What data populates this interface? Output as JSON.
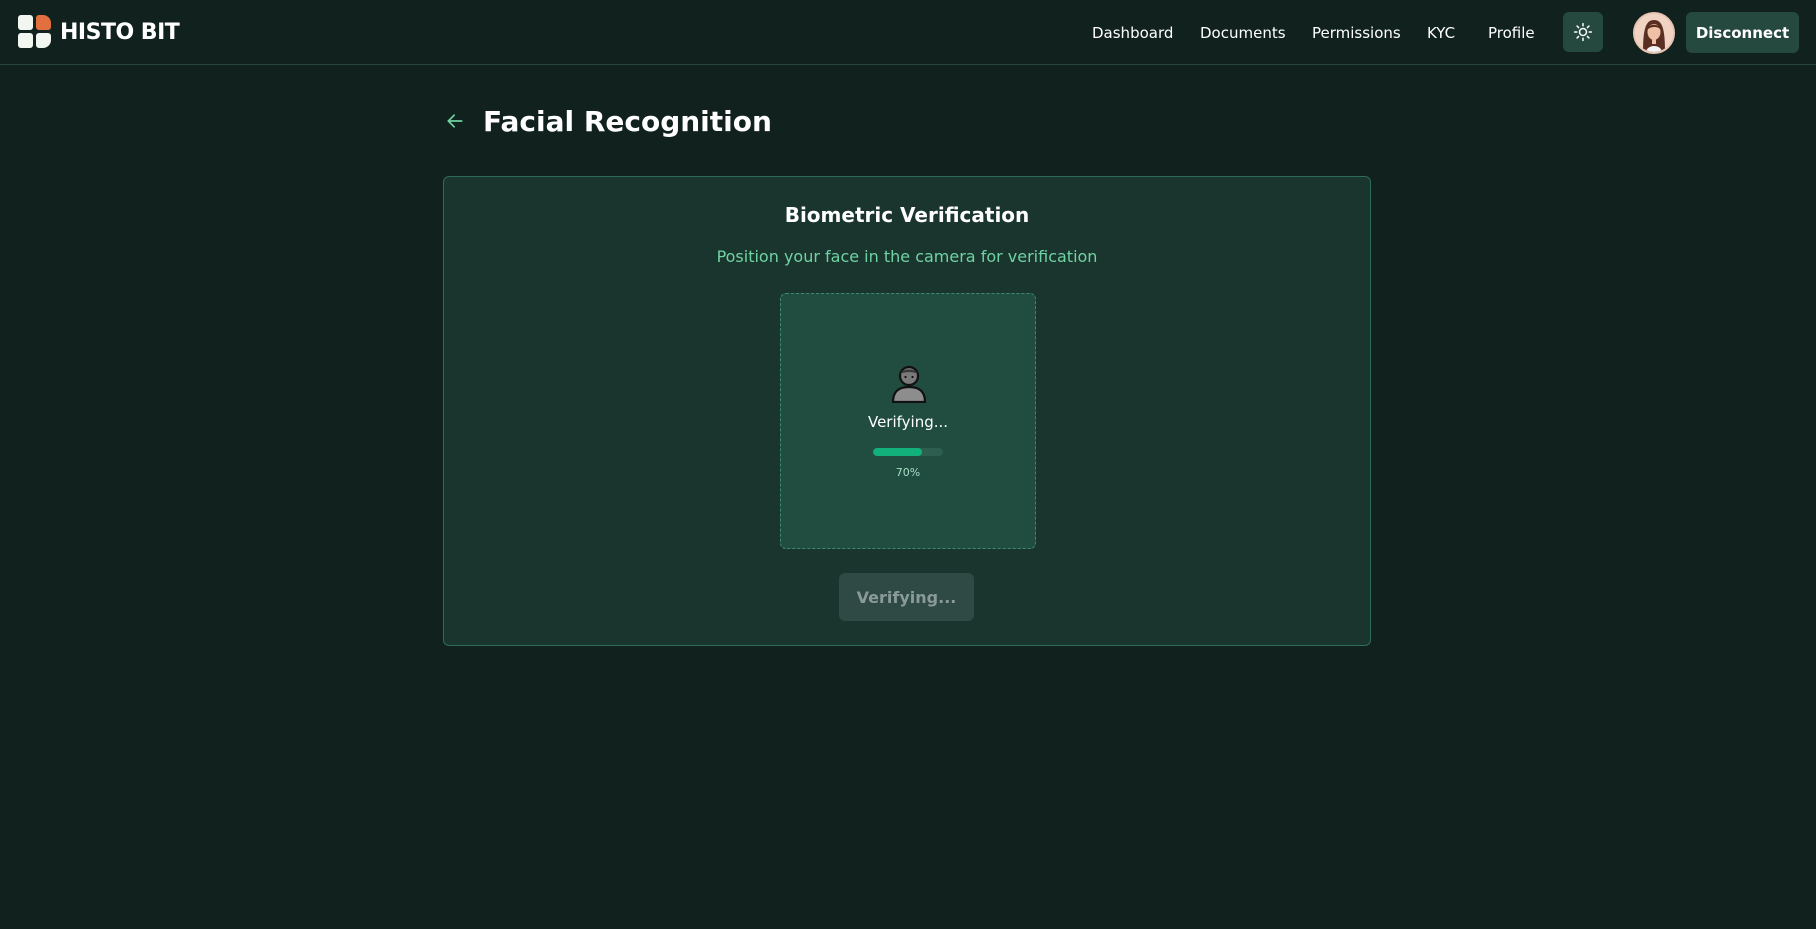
{
  "app": {
    "brand": "HISTO BIT"
  },
  "nav": {
    "items": [
      {
        "label": "Dashboard"
      },
      {
        "label": "Documents"
      },
      {
        "label": "Permissions"
      },
      {
        "label": "KYC"
      },
      {
        "label": "Profile"
      }
    ],
    "theme_toggle_icon": "sun-icon",
    "disconnect_label": "Disconnect"
  },
  "page": {
    "title": "Facial Recognition",
    "back_icon": "arrow-left-icon"
  },
  "card": {
    "title": "Biometric Verification",
    "subtitle": "Position your face in the camera for verification",
    "camera": {
      "icon": "person-icon",
      "status": "Verifying...",
      "progress_percent": 70,
      "progress_text": "70%"
    },
    "button_label": "Verifying..."
  },
  "colors": {
    "background": "#11221e",
    "card": "#1a352e",
    "accent": "#12b07a",
    "subtitle": "#6fd3a3",
    "brand_orange": "#e2703f"
  }
}
